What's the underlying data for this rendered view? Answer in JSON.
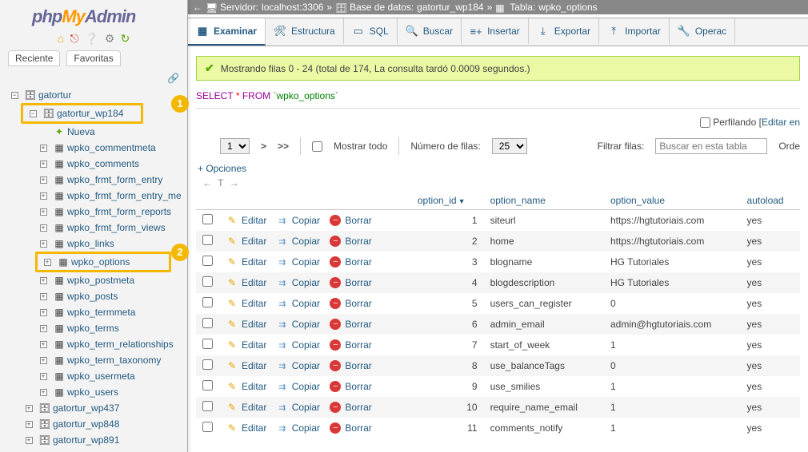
{
  "logo": {
    "php": "php",
    "my": "My",
    "admin": "Admin"
  },
  "left_tabs": {
    "recent": "Reciente",
    "favorites": "Favoritas"
  },
  "tree": {
    "root": "gatortur",
    "db_highlight": "gatortur_wp184",
    "new": "Nueva",
    "tables": [
      "wpko_commentmeta",
      "wpko_comments",
      "wpko_frmt_form_entry",
      "wpko_frmt_form_entry_me",
      "wpko_frmt_form_reports",
      "wpko_frmt_form_views",
      "wpko_links",
      "wpko_options",
      "wpko_postmeta",
      "wpko_posts",
      "wpko_termmeta",
      "wpko_terms",
      "wpko_term_relationships",
      "wpko_term_taxonomy",
      "wpko_usermeta",
      "wpko_users"
    ],
    "highlight_table_index": 7,
    "other_dbs": [
      "gatortur_wp437",
      "gatortur_wp848",
      "gatortur_wp891"
    ]
  },
  "callouts": {
    "one": "1",
    "two": "2"
  },
  "breadcrumb": {
    "server_label": "Servidor:",
    "server": "localhost:3306",
    "db_label": "Base de datos:",
    "db": "gatortur_wp184",
    "table_label": "Tabla:",
    "table": "wpko_options",
    "sep": "»"
  },
  "topmenu": [
    {
      "label": "Examinar",
      "active": true,
      "icon": "table"
    },
    {
      "label": "Estructura",
      "active": false,
      "icon": "struct"
    },
    {
      "label": "SQL",
      "active": false,
      "icon": "sql"
    },
    {
      "label": "Buscar",
      "active": false,
      "icon": "search"
    },
    {
      "label": "Insertar",
      "active": false,
      "icon": "insert"
    },
    {
      "label": "Exportar",
      "active": false,
      "icon": "export"
    },
    {
      "label": "Importar",
      "active": false,
      "icon": "import"
    },
    {
      "label": "Operac",
      "active": false,
      "icon": "ops"
    }
  ],
  "success": "Mostrando filas 0 - 24 (total de 174, La consulta tardó 0.0009 segundos.)",
  "sql": {
    "select": "SELECT",
    "star": "*",
    "from": "FROM",
    "table": "`wpko_options`"
  },
  "profiling": {
    "label": "Perfilando",
    "edit": "Editar en"
  },
  "toolbar": {
    "page": "1",
    "next": ">",
    "last": ">>",
    "show_all": "Mostrar todo",
    "rows_label": "Número de filas:",
    "rows": "25",
    "filter_label": "Filtrar filas:",
    "filter_placeholder": "Buscar en esta tabla",
    "order": "Orde"
  },
  "options": "+ Opciones",
  "columns": {
    "id": "option_id",
    "name": "option_name",
    "value": "option_value",
    "autoload": "autoload"
  },
  "actions": {
    "edit": "Editar",
    "copy": "Copiar",
    "delete": "Borrar"
  },
  "rows": [
    {
      "id": "1",
      "name": "siteurl",
      "value": "https://hgtutoriais.com",
      "autoload": "yes"
    },
    {
      "id": "2",
      "name": "home",
      "value": "https://hgtutoriais.com",
      "autoload": "yes"
    },
    {
      "id": "3",
      "name": "blogname",
      "value": "HG Tutoriales",
      "autoload": "yes"
    },
    {
      "id": "4",
      "name": "blogdescription",
      "value": "HG Tutoriales",
      "autoload": "yes"
    },
    {
      "id": "5",
      "name": "users_can_register",
      "value": "0",
      "autoload": "yes"
    },
    {
      "id": "6",
      "name": "admin_email",
      "value": "admin@hgtutoriais.com",
      "autoload": "yes"
    },
    {
      "id": "7",
      "name": "start_of_week",
      "value": "1",
      "autoload": "yes"
    },
    {
      "id": "8",
      "name": "use_balanceTags",
      "value": "0",
      "autoload": "yes"
    },
    {
      "id": "9",
      "name": "use_smilies",
      "value": "1",
      "autoload": "yes"
    },
    {
      "id": "10",
      "name": "require_name_email",
      "value": "1",
      "autoload": "yes"
    },
    {
      "id": "11",
      "name": "comments_notify",
      "value": "1",
      "autoload": "yes"
    }
  ]
}
